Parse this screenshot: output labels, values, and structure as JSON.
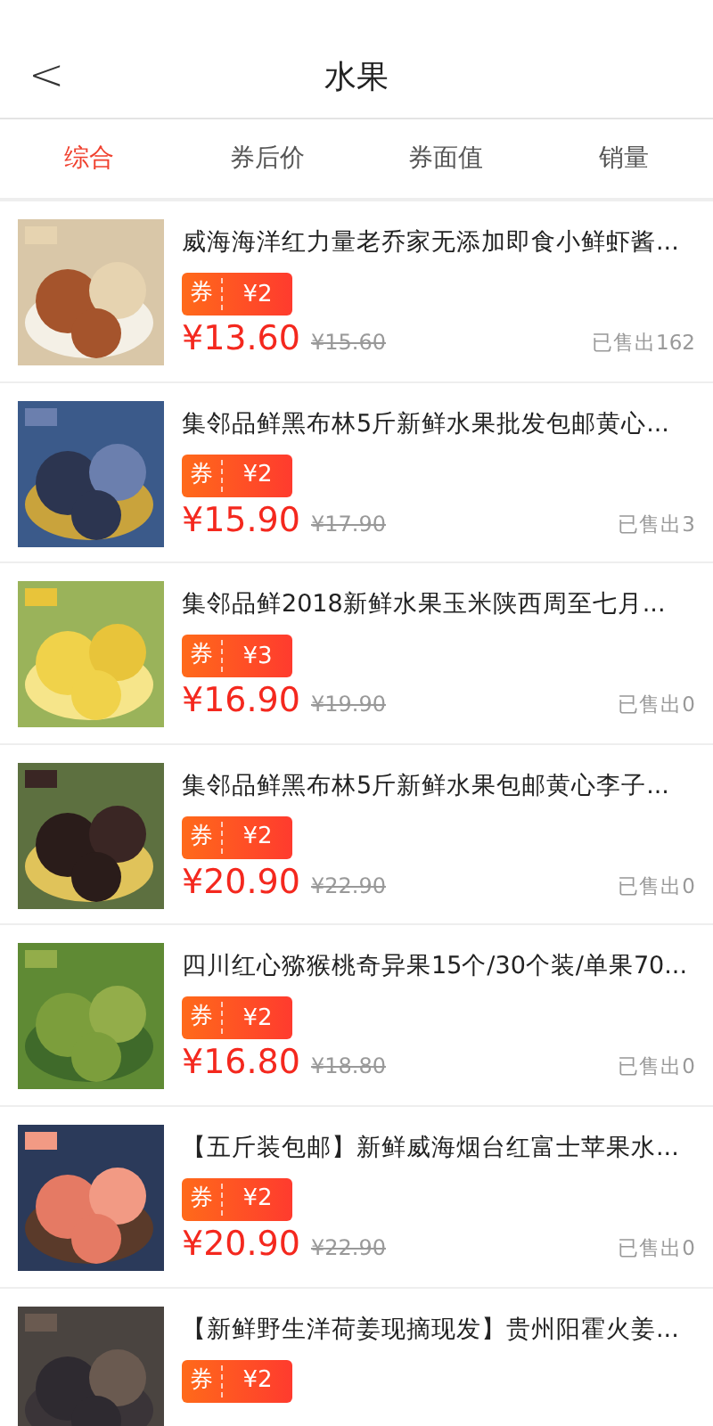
{
  "header": {
    "back": "<",
    "title": "水果"
  },
  "tabs": [
    {
      "label": "综合",
      "selected": true
    },
    {
      "label": "券后价",
      "selected": false
    },
    {
      "label": "券面值",
      "selected": false
    },
    {
      "label": "销量",
      "selected": false
    }
  ],
  "products": [
    {
      "title": "威海海洋红力量老乔家无添加即食小鲜虾酱...",
      "coupon_label": "券",
      "coupon": "¥2",
      "price": "¥13.60",
      "original_price": "¥15.60",
      "sold": "已售出162"
    },
    {
      "title": "集邻品鲜黑布林5斤新鲜水果批发包邮黄心...",
      "coupon_label": "券",
      "coupon": "¥2",
      "price": "¥15.90",
      "original_price": "¥17.90",
      "sold": "已售出3"
    },
    {
      "title": "集邻品鲜2018新鲜水果玉米陕西周至七月...",
      "coupon_label": "券",
      "coupon": "¥3",
      "price": "¥16.90",
      "original_price": "¥19.90",
      "sold": "已售出0"
    },
    {
      "title": "集邻品鲜黑布林5斤新鲜水果包邮黄心李子...",
      "coupon_label": "券",
      "coupon": "¥2",
      "price": "¥20.90",
      "original_price": "¥22.90",
      "sold": "已售出0"
    },
    {
      "title": "四川红心猕猴桃奇异果15个/30个装/单果70...",
      "coupon_label": "券",
      "coupon": "¥2",
      "price": "¥16.80",
      "original_price": "¥18.80",
      "sold": "已售出0"
    },
    {
      "title": "【五斤装包邮】新鲜威海烟台红富士苹果水...",
      "coupon_label": "券",
      "coupon": "¥2",
      "price": "¥20.90",
      "original_price": "¥22.90",
      "sold": "已售出0"
    },
    {
      "title": "【新鲜野生洋荷姜现摘现发】贵州阳霍火姜...",
      "coupon_label": "券",
      "coupon": "¥2"
    }
  ]
}
